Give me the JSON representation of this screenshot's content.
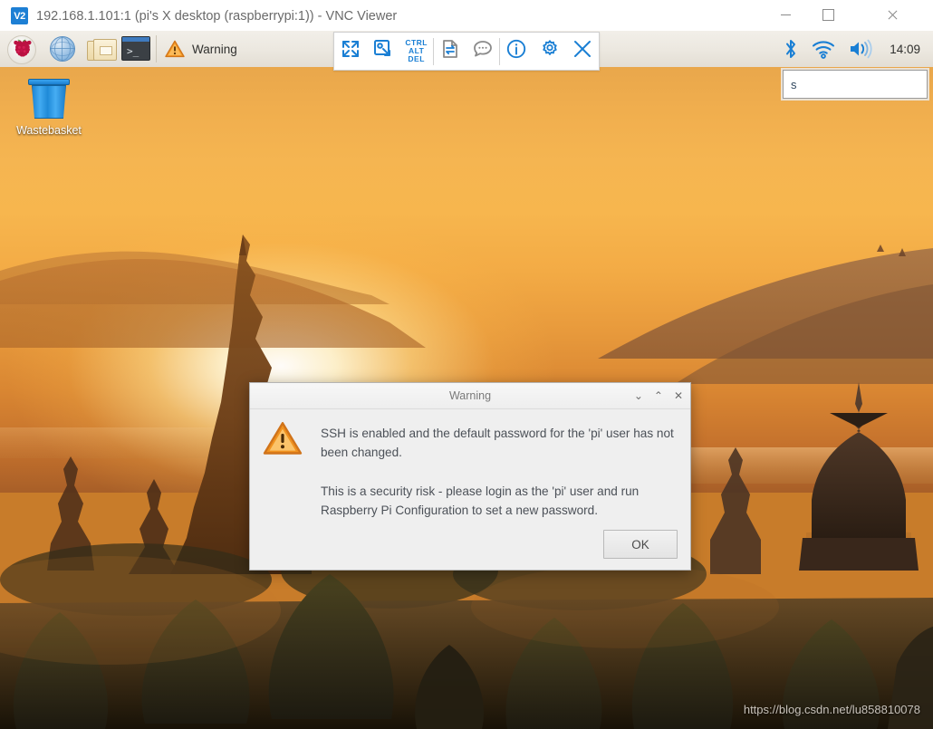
{
  "window": {
    "title": "192.168.1.101:1 (pi's X desktop (raspberrypi:1)) - VNC Viewer",
    "app_badge": "V2",
    "controls": {
      "minimize": "minimize-window",
      "maximize": "maximize-window",
      "close": "close-window"
    }
  },
  "taskbar": {
    "launchers": [
      {
        "name": "raspberry-menu",
        "tooltip": "Menu"
      },
      {
        "name": "web-browser",
        "tooltip": "Web Browser"
      },
      {
        "name": "file-manager",
        "tooltip": "File Manager"
      },
      {
        "name": "terminal",
        "tooltip": "Terminal"
      }
    ],
    "task_button": {
      "label": "Warning",
      "icon": "warning-icon"
    },
    "tray": {
      "bluetooth": "bluetooth-icon",
      "wifi": "wifi-icon",
      "volume": "volume-icon",
      "clock": "14:09"
    }
  },
  "vnc_toolbar": {
    "buttons": [
      {
        "name": "fullscreen",
        "label": ""
      },
      {
        "name": "windowed",
        "label": ""
      },
      {
        "name": "ctrl-alt-del",
        "label": "CTRL ALT DEL",
        "lines": [
          "CTRL",
          "ALT",
          "DEL"
        ]
      },
      {
        "name": "file-transfer",
        "label": ""
      },
      {
        "name": "chat",
        "label": ""
      },
      {
        "name": "connection-info",
        "label": ""
      },
      {
        "name": "options",
        "label": ""
      },
      {
        "name": "disconnect",
        "label": ""
      }
    ]
  },
  "desktop": {
    "icons": [
      {
        "name": "wastebasket",
        "label": "Wastebasket"
      }
    ],
    "text_field": {
      "value": "s",
      "placeholder": ""
    },
    "watermark": "https://blog.csdn.net/lu858810078"
  },
  "dialog": {
    "title": "Warning",
    "icon": "warning-icon",
    "paragraph1": "SSH is enabled and the default password for the 'pi' user has not been changed.",
    "paragraph2": "This is a security risk - please login as the 'pi' user and run Raspberry Pi Configuration to set a new password.",
    "ok_label": "OK",
    "titlebar_buttons": {
      "shade": "⌄",
      "unshade": "⌃",
      "close": "✕"
    }
  },
  "colors": {
    "accent_blue": "#1a7fd4",
    "warning_orange": "#f0921f",
    "taskbar_bg": "#ece8e0",
    "dialog_bg": "#efefef",
    "title_text": "#6a6a6a"
  }
}
